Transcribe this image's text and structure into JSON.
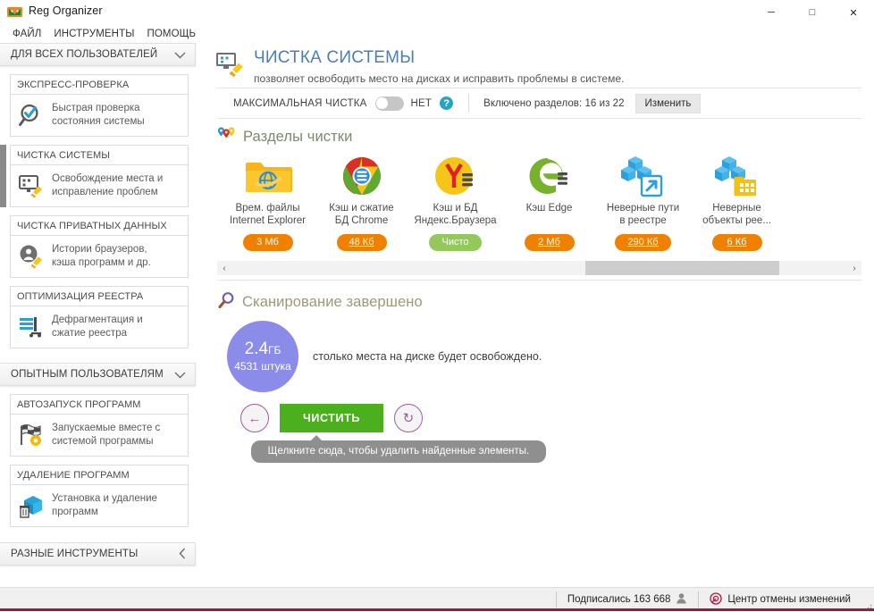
{
  "window": {
    "title": "Reg Organizer",
    "app_icon": "reg-organizer-logo",
    "minimize": "─",
    "maximize": "□",
    "close": "✕"
  },
  "menubar": {
    "items": [
      {
        "label": "ФАЙЛ",
        "name": "menu-file"
      },
      {
        "label": "ИНСТРУМЕНТЫ",
        "name": "menu-tools"
      },
      {
        "label": "ПОМОЩЬ",
        "name": "menu-help"
      }
    ]
  },
  "sidebar": {
    "groups": [
      {
        "header": "ДЛЯ ВСЕХ ПОЛЬЗОВАТЕЛЕЙ",
        "chevron": "chevron-down-icon",
        "sections": [
          {
            "title": "ЭКСПРЕСС-ПРОВЕРКА",
            "label_line1": "Быстрая проверка",
            "label_line2": "состояния системы",
            "icon": "magnifier-check-icon",
            "active": false
          },
          {
            "title": "ЧИСТКА СИСТЕМЫ",
            "label_line1": "Освобождение места и",
            "label_line2": "исправление проблем",
            "icon": "monitor-broom-icon",
            "active": true
          },
          {
            "title": "ЧИСТКА ПРИВАТНЫХ ДАННЫХ",
            "label_line1": "Истории браузеров,",
            "label_line2": "кэша программ и др.",
            "icon": "privacy-broom-icon",
            "active": false
          },
          {
            "title": "ОПТИМИЗАЦИЯ РЕЕСТРА",
            "label_line1": "Дефрагментация и",
            "label_line2": "сжатие реестра",
            "icon": "registry-defrag-icon",
            "active": false
          }
        ]
      },
      {
        "header": "ОПЫТНЫМ ПОЛЬЗОВАТЕЛЯМ",
        "chevron": "chevron-down-icon",
        "sections": [
          {
            "title": "АВТОЗАПУСК ПРОГРАММ",
            "label_line1": "Запускаемые вместе с",
            "label_line2": "системой программы",
            "icon": "checkered-flag-gear-icon",
            "active": false
          },
          {
            "title": "УДАЛЕНИЕ ПРОГРАММ",
            "label_line1": "Установка и удаление",
            "label_line2": "программ",
            "icon": "box-trash-icon",
            "active": false
          }
        ]
      },
      {
        "header": "РАЗНЫЕ ИНСТРУМЕНТЫ",
        "chevron": "chevron-left-icon",
        "sections": []
      }
    ]
  },
  "main": {
    "page": {
      "icon": "monitor-broom-icon",
      "title": "ЧИСТКА СИСТЕМЫ",
      "subtitle": "позволяет освободить место на дисках и исправить проблемы в системе."
    },
    "toolbar": {
      "max_clean_label": "МАКСИМАЛЬНАЯ ЧИСТКА",
      "toggle_state": "НЕТ",
      "toggle_on": false,
      "help_icon": "question-mark-icon",
      "help_glyph": "?",
      "enabled_sections": "Включено разделов: 16 из 22",
      "change_label": "Изменить"
    },
    "sections_panel": {
      "icon": "map-pins-icon",
      "title": "Разделы чистки",
      "tiles": [
        {
          "icon": "ie-folder-icon",
          "name_line1": "Врем. файлы",
          "name_line2": "Internet Explorer",
          "badge": "3 Мб",
          "badge_color": "orange",
          "badge_underline": false
        },
        {
          "icon": "chrome-icon",
          "name_line1": "Кэш и сжатие",
          "name_line2": "БД Chrome",
          "badge": "48 Кб",
          "badge_color": "orange",
          "badge_underline": true
        },
        {
          "icon": "yandex-browser-icon",
          "name_line1": "Кэш и БД",
          "name_line2": "Яндекс.Браузера",
          "badge": "Чисто",
          "badge_color": "green",
          "badge_underline": false
        },
        {
          "icon": "edge-icon",
          "name_line1": "Кэш Edge",
          "name_line2": "",
          "badge": "2 Мб",
          "badge_color": "orange",
          "badge_underline": true
        },
        {
          "icon": "registry-paths-icon",
          "name_line1": "Неверные пути",
          "name_line2": "в реестре",
          "badge": "290 Кб",
          "badge_color": "orange",
          "badge_underline": true
        },
        {
          "icon": "registry-objects-icon",
          "name_line1": "Неверные",
          "name_line2": "объекты рее...",
          "badge": "6 Кб",
          "badge_color": "orange",
          "badge_underline": true
        }
      ],
      "scroll_left": "‹",
      "scroll_right": "›"
    },
    "result": {
      "icon": "magnifier-icon",
      "title": "Сканирование завершено",
      "bubble_value": "2.4",
      "bubble_unit": "ГБ",
      "bubble_count": "4531 штука",
      "bubble_color": "#8b8bea",
      "description": "столько места на диске будет освобождено.",
      "back_button_icon": "arrow-left-circle-icon",
      "back_glyph": "←",
      "clean_button": "ЧИСТИТЬ",
      "rescan_button_icon": "refresh-circle-icon",
      "rescan_glyph": "↻",
      "tooltip": "Щелкните сюда, чтобы удалить найденные элементы."
    }
  },
  "statusbar": {
    "subscribers_label": "Подписались 163 668",
    "subscribers_icon": "user-icon",
    "undo_center_label": "Центр отмены изменений",
    "undo_center_icon": "undo-target-icon"
  },
  "colors": {
    "accent_title": "#4a7fb5",
    "clean_green": "#4caf1e",
    "badge_orange": "#f08000",
    "badge_green": "#93c95b",
    "bubble_purple": "#8b8bea",
    "bottom_accent": "#9b1b3f",
    "help_blue": "#2aa3c0"
  }
}
